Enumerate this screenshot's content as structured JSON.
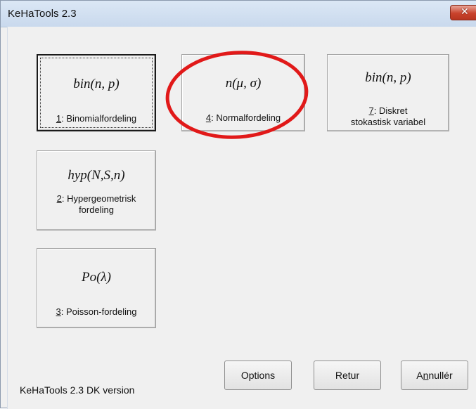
{
  "window": {
    "title": "KeHaTools 2.3",
    "close_glyph": "✕"
  },
  "tools": [
    {
      "formula": "bin(n, p)",
      "hotkey": "1",
      "text": ": Binomialfordeling"
    },
    {
      "formula": "n(μ, σ)",
      "hotkey": "4",
      "text": ": Normalfordeling"
    },
    {
      "formula": "bin(n, p)",
      "hotkey": "7",
      "text": ": Diskret stokastisk variabel"
    },
    {
      "formula": "hyp(N,S,n)",
      "hotkey": "2",
      "text": ": Hypergeometrisk fordeling"
    },
    {
      "formula": "Po(λ)",
      "hotkey": "3",
      "text": ": Poisson-fordeling"
    }
  ],
  "buttons": {
    "options": "Options",
    "retur": "Retur",
    "annuller_pre": "A",
    "annuller_hotkey": "n",
    "annuller_post": "nullér"
  },
  "footer": {
    "version": "KeHaTools 2.3  DK version"
  },
  "colors": {
    "highlight": "#e11919"
  },
  "icons": {
    "close": "close-icon"
  }
}
